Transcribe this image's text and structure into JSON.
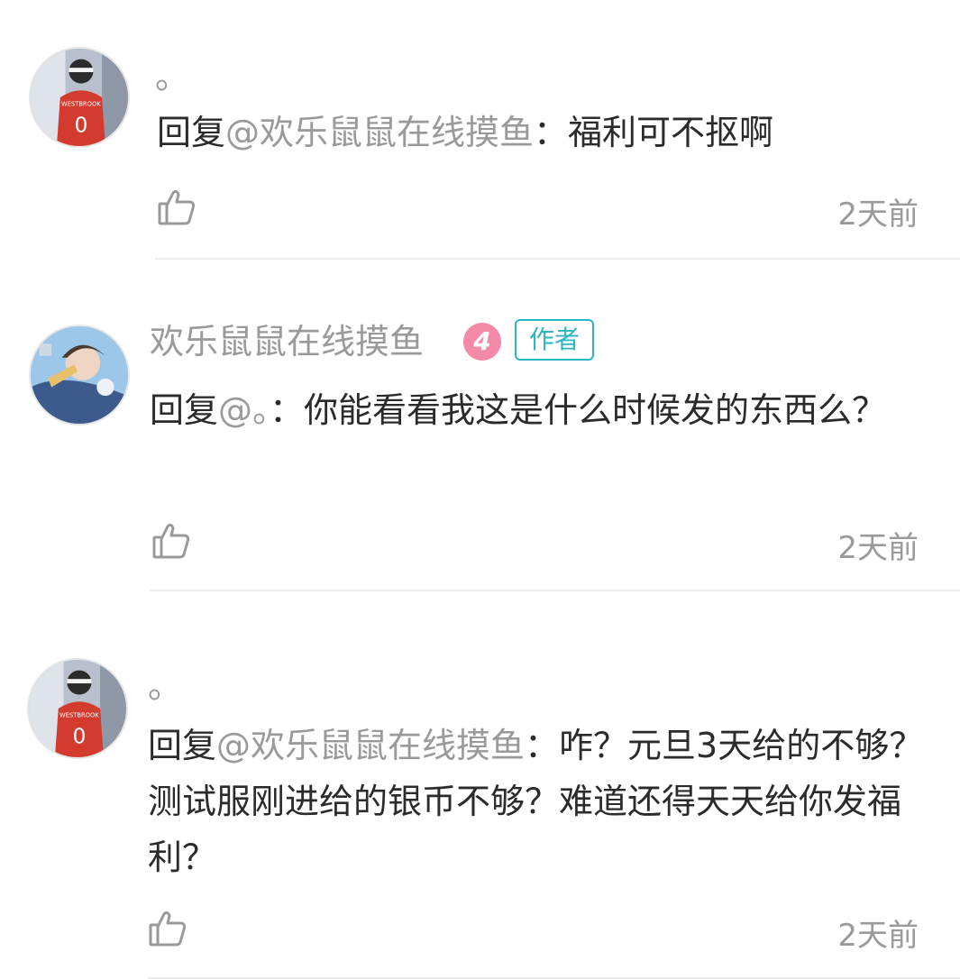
{
  "comments": [
    {
      "name": "。",
      "reply_prefix": "回复",
      "mention": "@欢乐鼠鼠在线摸鱼",
      "separator": "：",
      "text": "福利可不抠啊",
      "time": "2天前"
    },
    {
      "name": "欢乐鼠鼠在线摸鱼",
      "level": "4",
      "badge": "作者",
      "reply_prefix": "回复",
      "mention": "@。",
      "separator": "：",
      "text": "你能看看我这是什么时候发的东西么？",
      "time": "2天前"
    },
    {
      "name": "。",
      "reply_prefix": "回复",
      "mention": "@欢乐鼠鼠在线摸鱼",
      "separator": "：",
      "text": "咋？元旦3天给的不够？测试服刚进给的银币不够？难道还得天天给你发福利？",
      "time": "2天前"
    }
  ],
  "colors": {
    "text": "#2b2b2b",
    "muted": "#9a9a9a",
    "author_badge": "#2bb6c3",
    "level_badge": "#f58aa8"
  },
  "icons": {
    "like": "thumbs-up-icon",
    "avatar_basketball": "basketball-player-avatar",
    "avatar_anime": "anime-character-avatar"
  }
}
